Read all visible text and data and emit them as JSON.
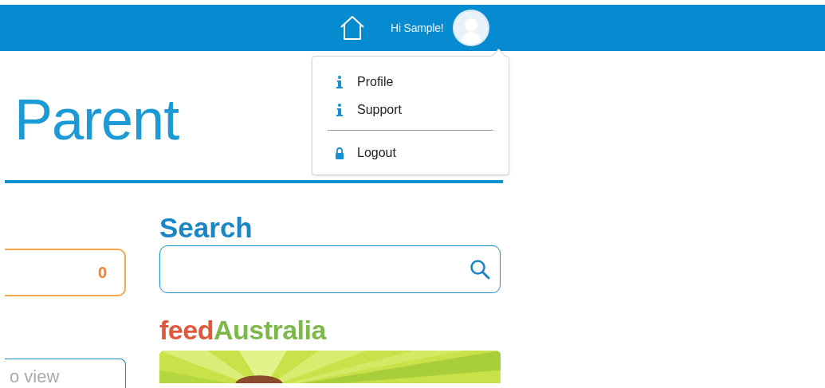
{
  "header": {
    "greeting": "Hi Sample!"
  },
  "user_menu": {
    "items": [
      {
        "label": "Profile",
        "kind": "link"
      },
      {
        "label": "Support",
        "kind": "link"
      },
      {
        "label": "Logout",
        "kind": "logout"
      }
    ]
  },
  "page": {
    "title": "Parent"
  },
  "left_column": {
    "counter": "0",
    "card_text": "o view"
  },
  "search": {
    "heading": "Search"
  },
  "logo": {
    "parts": [
      {
        "text": "feed",
        "color": "#e0573a"
      },
      {
        "text": "Australia",
        "color": "#7cb84a"
      }
    ]
  }
}
